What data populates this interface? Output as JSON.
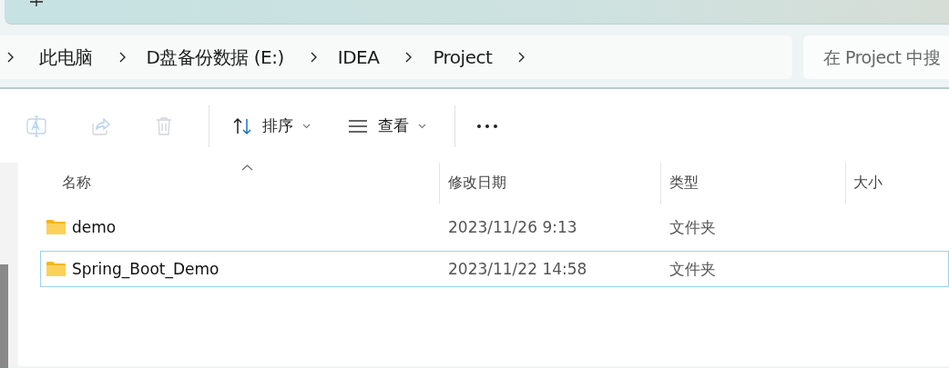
{
  "address_bar": {
    "crumbs": [
      {
        "label": "此电脑"
      },
      {
        "label": "D盘备份数据 (E:)"
      },
      {
        "label": "IDEA"
      },
      {
        "label": "Project"
      }
    ]
  },
  "search": {
    "placeholder": "在 Project 中搜"
  },
  "toolbar": {
    "items": [
      {
        "kind": "rename",
        "disabled": true
      },
      {
        "kind": "share",
        "disabled": true
      },
      {
        "kind": "delete",
        "disabled": true
      },
      {
        "kind": "separator"
      },
      {
        "kind": "sort",
        "label": "排序",
        "disabled": false
      },
      {
        "kind": "view",
        "label": "查看",
        "disabled": false
      },
      {
        "kind": "separator"
      },
      {
        "kind": "more",
        "disabled": false
      }
    ]
  },
  "columns": [
    {
      "label": "名称",
      "sorted": true
    },
    {
      "label": "修改日期",
      "sorted": false
    },
    {
      "label": "类型",
      "sorted": false
    },
    {
      "label": "大小",
      "sorted": false
    }
  ],
  "rows": [
    {
      "name": "demo",
      "modified": "2023/11/26 9:13",
      "type": "文件夹",
      "selected": false
    },
    {
      "name": "Spring_Boot_Demo",
      "modified": "2023/11/22 14:58",
      "type": "文件夹",
      "selected": true
    }
  ]
}
